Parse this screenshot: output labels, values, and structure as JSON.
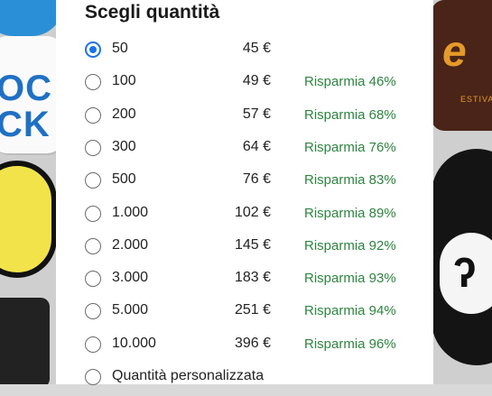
{
  "title": "Scegli quantità",
  "background": {
    "left_sticker_text": "OC\nCK",
    "right_sticker_text": "e",
    "right_sticker_small": "ESTIVAL"
  },
  "options": [
    {
      "quantity": "50",
      "price": "45 €",
      "saving": "",
      "selected": true
    },
    {
      "quantity": "100",
      "price": "49 €",
      "saving": "Risparmia 46%",
      "selected": false
    },
    {
      "quantity": "200",
      "price": "57 €",
      "saving": "Risparmia 68%",
      "selected": false
    },
    {
      "quantity": "300",
      "price": "64 €",
      "saving": "Risparmia 76%",
      "selected": false
    },
    {
      "quantity": "500",
      "price": "76 €",
      "saving": "Risparmia 83%",
      "selected": false
    },
    {
      "quantity": "1.000",
      "price": "102 €",
      "saving": "Risparmia 89%",
      "selected": false
    },
    {
      "quantity": "2.000",
      "price": "145 €",
      "saving": "Risparmia 92%",
      "selected": false
    },
    {
      "quantity": "3.000",
      "price": "183 €",
      "saving": "Risparmia 93%",
      "selected": false
    },
    {
      "quantity": "5.000",
      "price": "251 €",
      "saving": "Risparmia 94%",
      "selected": false
    },
    {
      "quantity": "10.000",
      "price": "396 €",
      "saving": "Risparmia 96%",
      "selected": false
    },
    {
      "quantity": "Quantità personalizzata",
      "price": "",
      "saving": "",
      "selected": false
    }
  ],
  "colors": {
    "accent": "#1a73e8",
    "saving": "#2e8540"
  }
}
